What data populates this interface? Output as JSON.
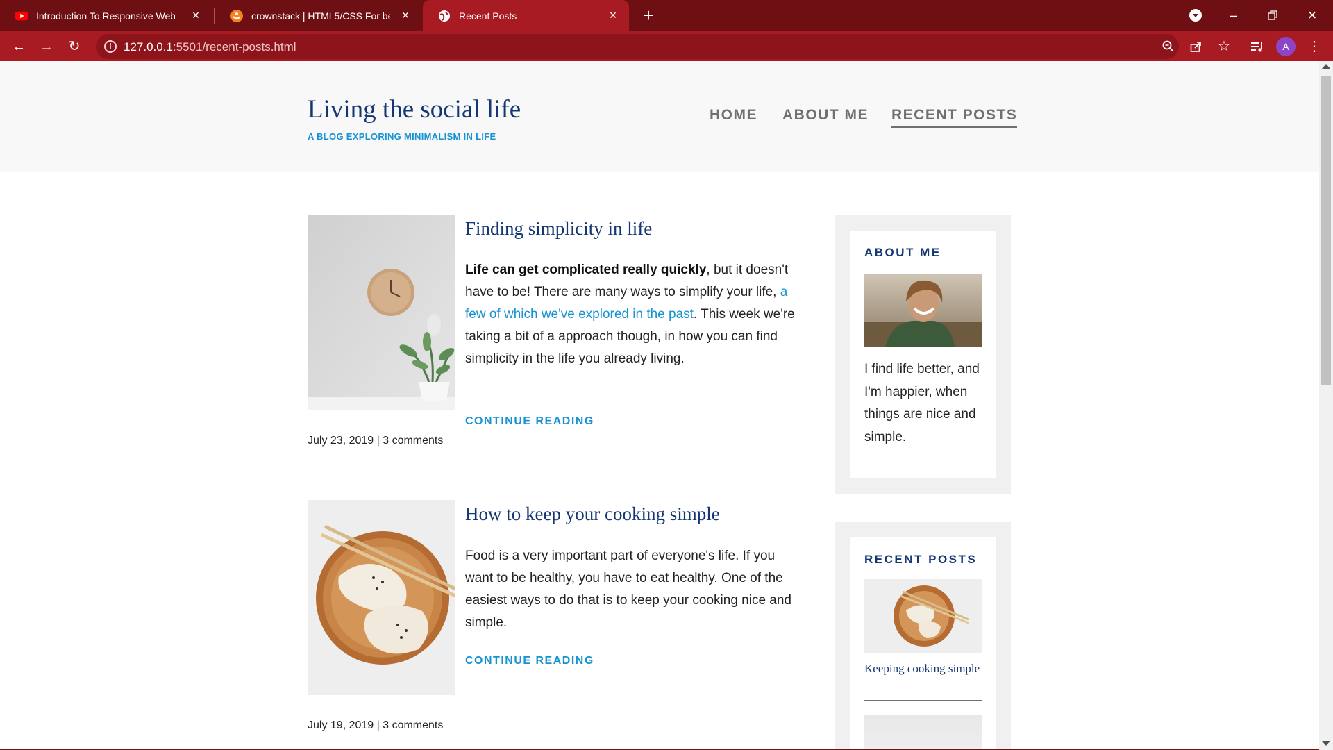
{
  "browser": {
    "tabs": [
      {
        "title": "Introduction To Responsive Web",
        "favicon": "youtube-icon"
      },
      {
        "title": "crownstack | HTML5/CSS For beg",
        "favicon": "crownstack-icon"
      },
      {
        "title": "Recent Posts",
        "favicon": "globe-icon",
        "active": true
      }
    ],
    "url_host": "127.0.0.1",
    "url_rest": ":5501/recent-posts.html",
    "profile_initial": "A",
    "colors": {
      "tabbar": "#6e0f14",
      "toolbar": "#a81b22",
      "omnibox": "#8c141a"
    }
  },
  "site": {
    "title": "Living the social life",
    "subtitle": "A BLOG EXPLORING MINIMALISM IN LIFE",
    "nav": [
      {
        "label": "HOME",
        "active": false
      },
      {
        "label": "ABOUT ME",
        "active": false
      },
      {
        "label": "RECENT POSTS",
        "active": true
      }
    ],
    "colors": {
      "title": "#143774",
      "accent": "#1792d2",
      "nav": "#707070"
    }
  },
  "articles": [
    {
      "title": "Finding simplicity in life",
      "body_bold": "Life can get complicated really quickly",
      "body_part1": ", but it doesn't have to be! There are many ways to simplify your life, ",
      "body_link": "a few of which we've explored in the past",
      "body_part2": ". This week we're taking a bit of a approach though, in how you can find simplicity in the life you already living.",
      "continue_label": "CONTINUE READING",
      "meta": "July 23, 2019 | 3 comments",
      "image": "clock-and-plant-photo"
    },
    {
      "title": "How to keep your cooking simple",
      "body": "Food is a very important part of everyone's life. If you want to be healthy, you have to eat healthy. One of the easiest ways to do that is to keep your cooking nice and simple.",
      "continue_label": "CONTINUE READING",
      "meta": "July 19, 2019 | 3 comments",
      "image": "dumplings-photo"
    }
  ],
  "sidebar": {
    "about": {
      "title": "ABOUT ME",
      "text": "I find life better, and I'm happier, when things are nice and simple.",
      "image": "smiling-man-photo"
    },
    "recent": {
      "title": "RECENT POSTS",
      "items": [
        {
          "caption": "Keeping cooking simple",
          "image": "dumplings-thumbnail"
        }
      ]
    }
  }
}
